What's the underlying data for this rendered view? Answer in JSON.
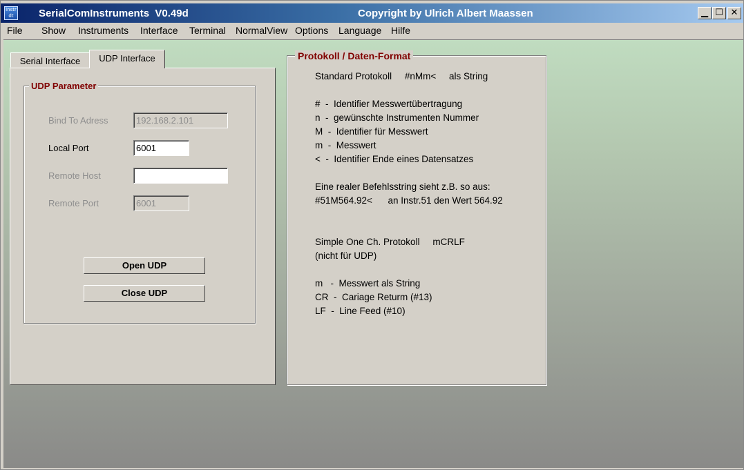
{
  "window": {
    "title": "SerialComInstruments  V0.49d",
    "copyright": "Copyright by Ulrich Albert Maassen",
    "icon_text_top": "Instr",
    "icon_text_bottom": "dt",
    "controls": {
      "minimize": "▁",
      "maximize": "☐",
      "close": "✕"
    }
  },
  "menu": [
    "File",
    "Show",
    "Instruments",
    "Interface",
    "Terminal",
    "NormalView",
    "Options",
    "Language",
    "Hilfe"
  ],
  "tabs": {
    "serial": "Serial Interface",
    "udp": "UDP Interface",
    "active": "UDP Interface"
  },
  "udp_group": {
    "title": "UDP Parameter",
    "bind_label": "Bind To Adress",
    "bind_value": "192.168.2.101",
    "local_port_label": "Local Port",
    "local_port_value": "6001",
    "remote_host_label": "Remote Host",
    "remote_host_value": "",
    "remote_port_label": "Remote Port",
    "remote_port_value": "6001",
    "open_button": "Open UDP",
    "close_button": "Close UDP"
  },
  "protocol": {
    "title": "Protokoll / Daten-Format",
    "lines": [
      "Standard Protokoll     #nMm<     als String",
      "#  -  Identifier Messwertübertragung",
      "n  -  gewünschte Instrumenten Nummer",
      "M  -  Identifier für Messwert",
      "m  -  Messwert",
      "<  -  Identifier Ende eines Datensatzes",
      "Eine realer Befehlsstring sieht z.B. so aus:",
      "#51M564.92<      an Instr.51 den Wert 564.92",
      "Simple One Ch. Protokoll     mCRLF",
      "(nicht für UDP)",
      "m   -  Messwert als String",
      "CR  -  Cariage Returm (#13)",
      "LF  -  Line Feed (#10)"
    ]
  },
  "colors": {
    "group_title": "#800000",
    "titlebar_start": "#0a246a",
    "titlebar_end": "#a6caf0",
    "face": "#d4d0c8"
  }
}
